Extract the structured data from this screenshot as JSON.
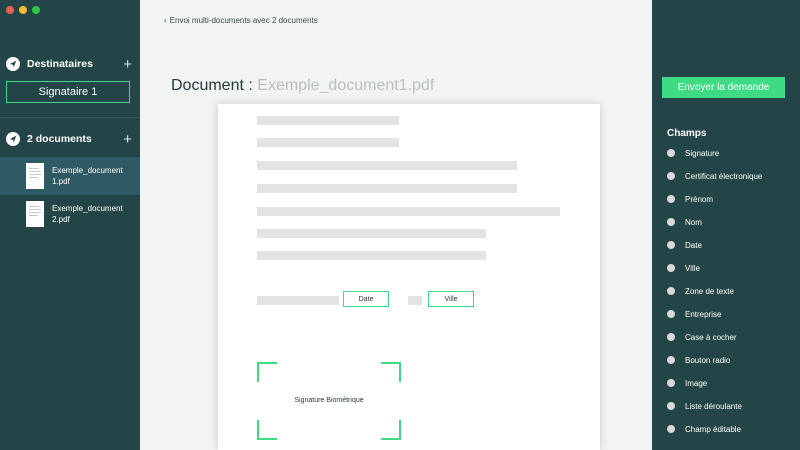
{
  "sidebar": {
    "recipients_title": "Destinataires",
    "signer_label": "Signataire 1",
    "documents_title": "2 documents",
    "documents": [
      {
        "name": "Exemple_document1.pdf"
      },
      {
        "name": "Exemple_document2.pdf"
      }
    ]
  },
  "main": {
    "back_label": "Envoi multi-documents avec 2 documents",
    "title_prefix": "Document :",
    "title_filename": "Exemple_document1.pdf",
    "fields": {
      "date": "Date",
      "ville": "Ville",
      "signature": "Signature Biométrique"
    }
  },
  "right": {
    "send_button": "Envoyer la demande",
    "champs_title": "Champs",
    "champs": [
      "Signature",
      "Certificat électronique",
      "Prénom",
      "Nom",
      "Date",
      "Ville",
      "Zone de texte",
      "Entreprise",
      "Case à cocher",
      "Bouton radio",
      "Image",
      "Liste déroulante",
      "Champ éditable"
    ]
  },
  "colors": {
    "sidebar_bg": "#234547",
    "accent_green": "#3ddc84",
    "active_item": "#2e5a63"
  }
}
